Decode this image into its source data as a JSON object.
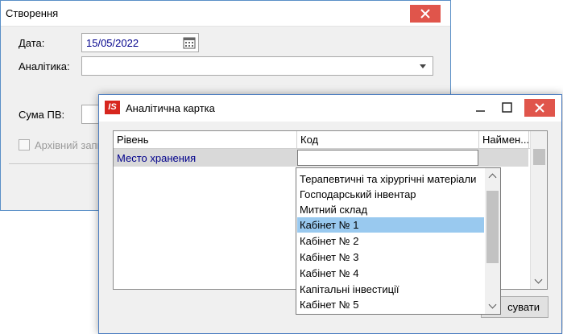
{
  "back_window": {
    "title": "Створення",
    "date_label": "Дата:",
    "date_value": "15/05/2022",
    "analytics_label": "Аналітика:",
    "analytics_value": "",
    "sum_label": "Сума ПВ:",
    "archive_label": "Архівний запи"
  },
  "front_window": {
    "title": "Аналітична картка",
    "logo_text": "IS",
    "columns": [
      "Рівень",
      "Код",
      "Наймен..."
    ],
    "row": {
      "level": "Место хранения",
      "code": ""
    },
    "cancel_label": "сувати"
  },
  "dropdown": {
    "items": [
      "Терапевтичні та хірургічні матеріали",
      "Господарський інвентар",
      "Митний склад",
      "Кабінет № 1",
      "Кабінет № 2",
      "Кабінет № 3",
      "Кабінет № 4",
      "Капітальні інвестиції",
      "Кабінет № 5"
    ],
    "selected": "Кабінет № 1"
  },
  "colors": {
    "close_button": "#e0554b",
    "selection": "#99c9ef",
    "value_text": "#00008b",
    "logo": "#d7261e"
  }
}
